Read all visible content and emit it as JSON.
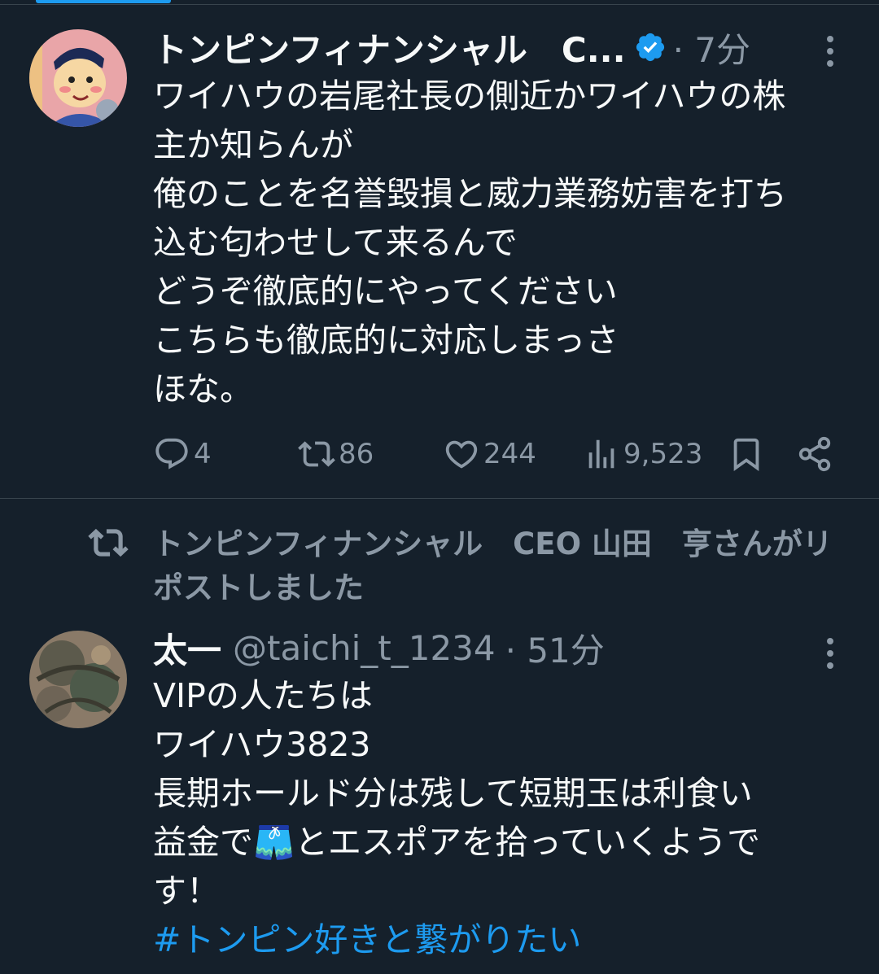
{
  "tweet1": {
    "display_name": "トンピンフィナンシャル　C...",
    "time": "· 7分",
    "body": "ワイハウの岩尾社長の側近かワイハウの株\n主か知らんが\n俺のことを名誉毀損と威力業務妨害を打ち\n込む匂わせして来るんで\nどうぞ徹底的にやってください\nこちらも徹底的に対応しまっさ\nほな。",
    "reply_count": "4",
    "repost_count": "86",
    "like_count": "244",
    "view_count": "9,523"
  },
  "repost_notice": "トンピンフィナンシャル　CEO 山田　亨さんがリポストしました",
  "tweet2": {
    "display_name": "太一",
    "handle": "@taichi_t_1234",
    "time": "· 51分",
    "body_before_emoji": "VIPの人たちは\nワイハウ3823\n長期ホールド分は残して短期玉は利食い\n益金で",
    "emoji": "🩳",
    "body_after_emoji": "とエスポアを拾っていくようで\nす！",
    "hashtag": "#トンピン好きと繋がりたい"
  },
  "colors": {
    "background": "#15202b",
    "text": "#f7f9f9",
    "secondary": "#8b98a5",
    "accent": "#1d9bf0",
    "divider": "#38444d"
  },
  "icons": [
    "reply-icon",
    "repost-icon",
    "like-icon",
    "views-icon",
    "bookmark-icon",
    "share-icon",
    "more-icon",
    "verified-badge-icon"
  ]
}
